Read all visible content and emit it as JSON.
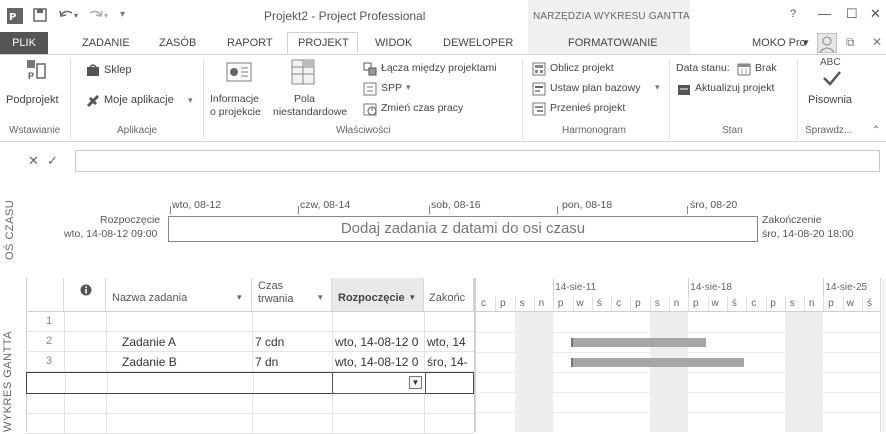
{
  "window": {
    "title": "Projekt2 - Project Professional",
    "context_group": "NARZĘDZIA WYKRESU GANTTA",
    "help": "?",
    "minimize": "—",
    "restore": "☐",
    "close": "✕"
  },
  "tabs": {
    "file": "PLIK",
    "items": [
      "ZADANIE",
      "ZASÓB",
      "RAPORT",
      "PROJEKT",
      "WIDOK",
      "DEWELOPER",
      "FORMATOWANIE"
    ],
    "active": "PROJEKT",
    "user": "MOKO Pro"
  },
  "ribbon": {
    "insert": {
      "subproject": "Podprojekt",
      "group": "Wstawianie"
    },
    "apps": {
      "store": "Sklep",
      "my_apps": "Moje aplikacje",
      "group": "Aplikacje"
    },
    "properties": {
      "info": [
        "Informacje",
        "o projekcie"
      ],
      "fields": [
        "Pola",
        "niestandardowe"
      ],
      "links": "Łącza między projektami",
      "wbs": "SPP",
      "change_time": "Zmień czas pracy",
      "group": "Właściwości"
    },
    "schedule": {
      "calc": "Oblicz projekt",
      "baseline": "Ustaw plan bazowy",
      "move": "Przenieś projekt",
      "group": "Harmonogram"
    },
    "status": {
      "status_date_label": "Data stanu:",
      "status_date_value": "Brak",
      "update": "Aktualizuj projekt",
      "group": "Stan"
    },
    "proofing": {
      "spelling": "Pisownia",
      "abc": "ABC",
      "group": "Sprawdz..."
    }
  },
  "formula_bar": {
    "cancel": "✕",
    "accept": "✓",
    "value": ""
  },
  "timeline": {
    "side_label": "OŚ CZASU",
    "start_label": "Rozpoczęcie",
    "start_date": "wto, 14-08-12 09:00",
    "end_label": "Zakończenie",
    "end_date": "śro, 14-08-20 18:00",
    "placeholder": "Dodaj zadania z datami do osi czasu",
    "ticks": [
      "wto, 08-12",
      "czw, 08-14",
      "sob, 08-16",
      "pon, 08-18",
      "śro, 08-20"
    ]
  },
  "grid": {
    "side_label": "WYKRES GANTTA",
    "columns": {
      "name": "Nazwa zadania",
      "duration": [
        "Czas",
        "trwania"
      ],
      "start": "Rozpoczęcie",
      "finish": "Zakońc"
    },
    "rows": [
      {
        "id": "1",
        "name": "",
        "duration": "",
        "start": "",
        "finish": ""
      },
      {
        "id": "2",
        "name": "Zadanie A",
        "duration": "7 cdn",
        "start": "wto, 14-08-12 0",
        "finish": "wto, 14"
      },
      {
        "id": "3",
        "name": "Zadanie B",
        "duration": "7 dn",
        "start": "wto, 14-08-12 0",
        "finish": "śro, 14-"
      }
    ]
  },
  "gantt": {
    "weeks": [
      "14-sie-11",
      "14-sie-18",
      "14-sie-25"
    ],
    "days": [
      "c",
      "p",
      "s",
      "n",
      "p",
      "w",
      "ś",
      "c",
      "p",
      "s",
      "n",
      "p",
      "w",
      "ś",
      "c",
      "p",
      "s",
      "n",
      "p",
      "w",
      "ś"
    ],
    "bars": [
      {
        "task": "Zadanie A",
        "start_day": 1,
        "length_days": 7
      },
      {
        "task": "Zadanie B",
        "start_day": 1,
        "length_days": 9
      }
    ]
  },
  "colors": {
    "accent": "#555555",
    "bar": "#a6a6a6",
    "context_band": "#f0f0f0"
  }
}
